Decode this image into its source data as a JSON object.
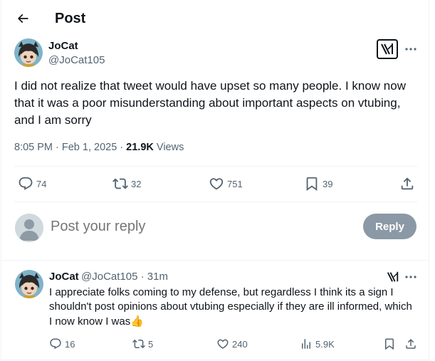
{
  "header": {
    "title": "Post"
  },
  "tweet": {
    "author_name": "JoCat",
    "author_handle": "@JoCat105",
    "text": "I did not realize that tweet would have upset so many people. I know now that it was a poor misunderstanding about important aspects on vtubing, and I am sorry",
    "time": "8:05 PM · Feb 1, 2025 · ",
    "views_count": "21.9K",
    "views_label": " Views",
    "stats": {
      "replies": "74",
      "reposts": "32",
      "likes": "751",
      "bookmarks": "39"
    }
  },
  "composer": {
    "placeholder": "Post your reply",
    "reply_label": "Reply"
  },
  "reply": {
    "author_name": "JoCat",
    "author_handle": "@JoCat105 · 31m",
    "text": "I appreciate folks coming to my defense, but regardless I think its a sign I shouldn't post opinions about vtubing especially if they are ill informed, which I now know I was",
    "emoji": "👍",
    "stats": {
      "replies": "16",
      "reposts": "5",
      "likes": "240",
      "views": "5.9K"
    }
  },
  "icons": {
    "back": "arrow-left-icon",
    "grok": "grok-icon",
    "more": "more-icon",
    "reply": "reply-icon",
    "repost": "repost-icon",
    "like": "heart-icon",
    "bookmark": "bookmark-icon",
    "share": "share-icon",
    "views": "views-icon"
  },
  "colors": {
    "text": "#0f1419",
    "secondary": "#536471",
    "divider": "#eff3f4",
    "reply_button": "#8b98a5"
  }
}
